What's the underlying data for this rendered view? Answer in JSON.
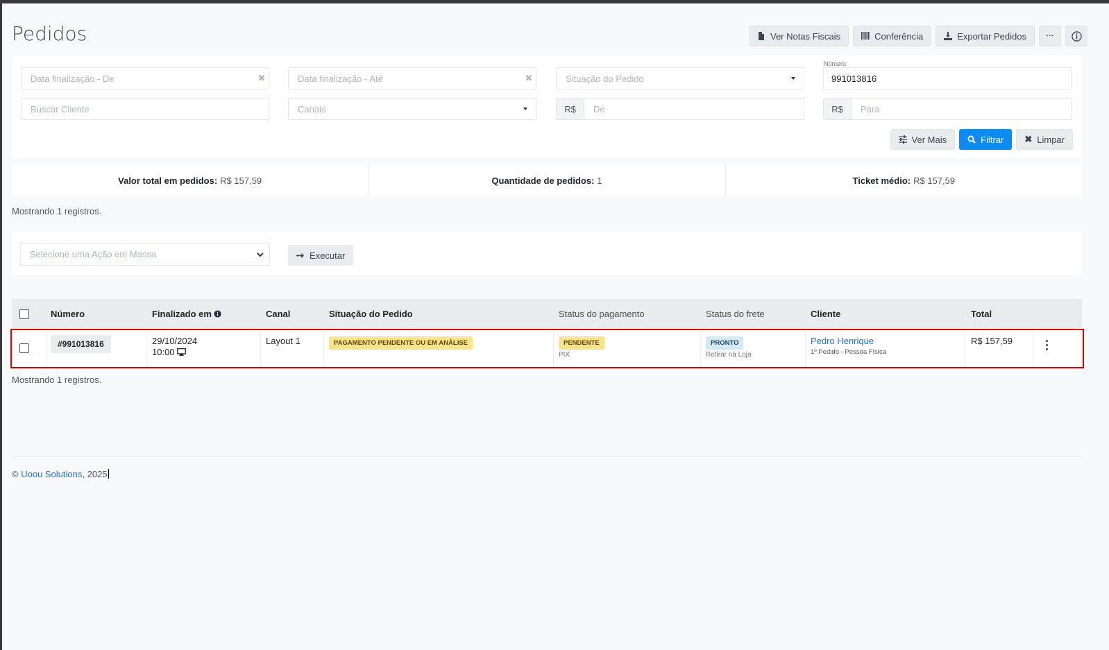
{
  "page": {
    "title": "Pedidos"
  },
  "toolbar": {
    "notas_label": "Ver Notas Fiscais",
    "conferencia_label": "Conferência",
    "exportar_label": "Exportar Pedidos",
    "more_label": "···"
  },
  "filters": {
    "data_de_placeholder": "Data finalização - De",
    "data_ate_placeholder": "Data finalização - Até",
    "situacao_placeholder": "Situação do Pedido",
    "numero_label": "Número",
    "numero_value": "991013816",
    "cliente_placeholder": "Buscar Cliente",
    "canais_placeholder": "Canais",
    "currency_prefix": "R$",
    "valor_de_placeholder": "De",
    "valor_para_placeholder": "Para",
    "ver_mais_label": "Ver Mais",
    "filtrar_label": "Filtrar",
    "limpar_label": "Limpar"
  },
  "summary": {
    "total_label": "Valor total em pedidos:",
    "total_value": "R$ 157,59",
    "qtd_label": "Quantidade de pedidos:",
    "qtd_value": "1",
    "ticket_label": "Ticket médio:",
    "ticket_value": "R$ 157,59"
  },
  "records_text": "Mostrando 1 registros.",
  "mass_action": {
    "select_placeholder": "Selecione uma Ação em Massa",
    "execute_label": "Executar"
  },
  "table": {
    "headers": {
      "numero": "Número",
      "finalizado": "Finalizado em",
      "canal": "Canal",
      "situacao": "Situação do Pedido",
      "pagamento": "Status do pagamento",
      "frete": "Status do frete",
      "cliente": "Cliente",
      "total": "Total"
    },
    "rows": [
      {
        "numero": "#991013816",
        "data": "29/10/2024",
        "hora": "10:00",
        "canal": "Layout 1",
        "situacao": "PAGAMENTO PENDENTE OU EM ANÁLISE",
        "pagamento_status": "PENDENTE",
        "pagamento_metodo": "PIX",
        "frete_status": "PRONTO",
        "frete_metodo": "Retirar na Loja",
        "cliente_nome": "Pedro Henrique",
        "cliente_info": "1º Pedido - Pessoa Física",
        "total": "R$ 157,59"
      }
    ]
  },
  "footer": {
    "copyright": "©",
    "company": "Uoou Solutions",
    "year": ", 2025"
  },
  "colors": {
    "primary": "#0d8bf2",
    "highlight": "#e00000",
    "badge_yellow": "#fbe38e",
    "badge_blue": "#d3eaf5"
  }
}
